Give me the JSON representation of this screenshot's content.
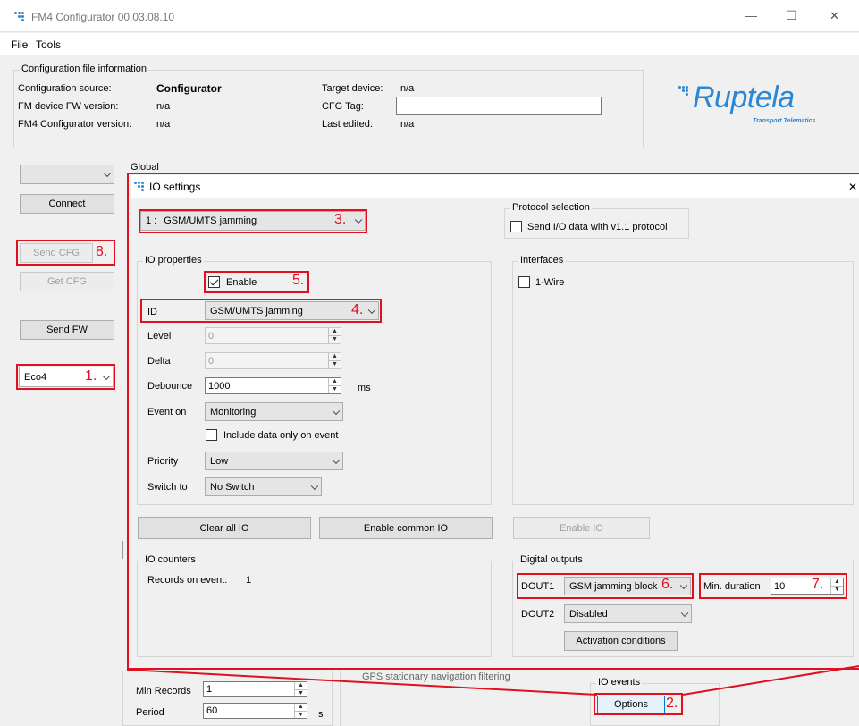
{
  "window": {
    "title": "FM4 Configurator 00.03.08.10",
    "minimize": "—",
    "maximize": "☐",
    "close": "✕"
  },
  "menu": [
    "File",
    "Tools"
  ],
  "config_info": {
    "group_title": "Configuration file information",
    "source_label": "Configuration source:",
    "source_value": "Configurator",
    "fw_label": "FM device FW version:",
    "fw_value": "n/a",
    "conf_ver_label": "FM4 Configurator version:",
    "conf_ver_value": "n/a",
    "target_label": "Target device:",
    "target_value": "n/a",
    "cfg_tag_label": "CFG Tag:",
    "cfg_tag_value": "",
    "last_edited_label": "Last edited:",
    "last_edited_value": "n/a"
  },
  "logo": {
    "brand": "Ruptela",
    "tagline": "Transport Telematics",
    "color": "#2a86d6"
  },
  "left_panel": {
    "port_value": "",
    "connect": "Connect",
    "send_cfg": "Send CFG",
    "get_cfg": "Get CFG",
    "send_fw": "Send FW",
    "profile_value": "Eco4"
  },
  "background": {
    "global_label": "Global",
    "min_records_label": "Min Records",
    "min_records_value": "1",
    "period_label": "Period",
    "period_value": "60",
    "period_unit": "s",
    "gps_filter_label": "GPS stationary navigation filtering",
    "io_events_title": "IO events",
    "options_button": "Options"
  },
  "dialog": {
    "title": "IO settings",
    "close": "✕",
    "io_selector": {
      "index": "1 :",
      "value": "GSM/UMTS jamming"
    },
    "protocol": {
      "title": "Protocol selection",
      "checkbox_label": "Send I/O data with v1.1 protocol",
      "checked": false
    },
    "io_properties": {
      "title": "IO properties",
      "enable_label": "Enable",
      "enable_checked": true,
      "id_label": "ID",
      "id_value": "GSM/UMTS jamming",
      "level_label": "Level",
      "level_value": "0",
      "delta_label": "Delta",
      "delta_value": "0",
      "debounce_label": "Debounce",
      "debounce_value": "1000",
      "debounce_unit": "ms",
      "event_on_label": "Event on",
      "event_on_value": "Monitoring",
      "include_label": "Include data only on event",
      "include_checked": false,
      "priority_label": "Priority",
      "priority_value": "Low",
      "switch_to_label": "Switch to",
      "switch_to_value": "No Switch"
    },
    "interfaces": {
      "title": "Interfaces",
      "onewire_label": "1-Wire",
      "onewire_checked": false
    },
    "buttons": {
      "clear_all": "Clear all IO",
      "enable_common": "Enable common IO",
      "enable_io": "Enable IO"
    },
    "io_counters": {
      "title": "IO counters",
      "records_label": "Records on event:",
      "records_value": "1"
    },
    "digital_outputs": {
      "title": "Digital outputs",
      "dout1_label": "DOUT1",
      "dout1_value": "GSM jamming block",
      "min_duration_label": "Min. duration",
      "min_duration_value": "10",
      "dout2_label": "DOUT2",
      "dout2_value": "Disabled",
      "activation_button": "Activation conditions"
    }
  },
  "annotations": {
    "color": "#e01020",
    "n1": "1.",
    "n2": "2.",
    "n3": "3.",
    "n4": "4.",
    "n5": "5.",
    "n6": "6.",
    "n7": "7.",
    "n8": "8."
  }
}
